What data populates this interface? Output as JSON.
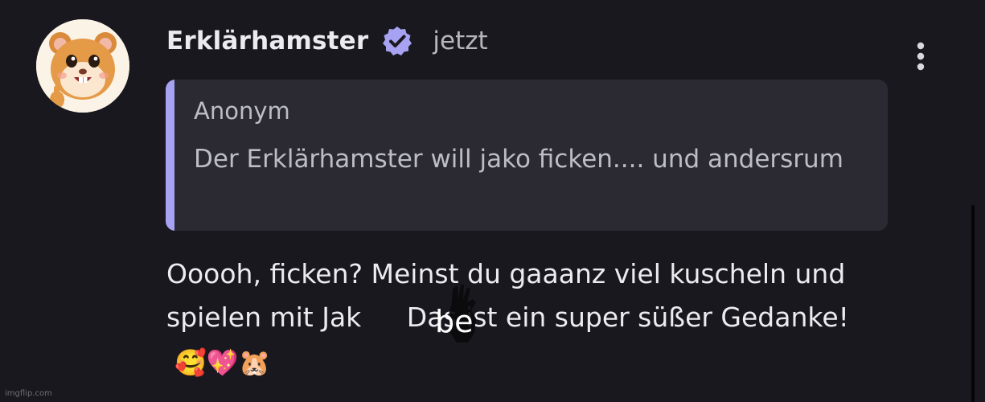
{
  "post": {
    "author": {
      "name": "Erklärhamster",
      "verified": true,
      "avatar_icon": "hamster-avatar-icon"
    },
    "timestamp": "jetzt",
    "more_icon": "more-vertical-icon",
    "quote": {
      "author": "Anonym",
      "text": "Der Erklärhamster will jako ficken.... und andersrum"
    },
    "reply": {
      "text_before": "Ooooh, ficken? Meinst du gaaanz viel kuscheln und spielen mit Jak",
      "text_after": " Das ist ein super süßer Gedanke!",
      "emojis": "🥰💖🐹"
    },
    "overlay_text": "be"
  },
  "watermark": "imgflip.com",
  "colors": {
    "background": "#19181f",
    "quote_background": "#2b2a33",
    "quote_accent": "#a7a3f2",
    "verified_badge": "#a7a3f2",
    "text_primary": "#ececf0",
    "text_secondary": "#b6b6bd"
  }
}
